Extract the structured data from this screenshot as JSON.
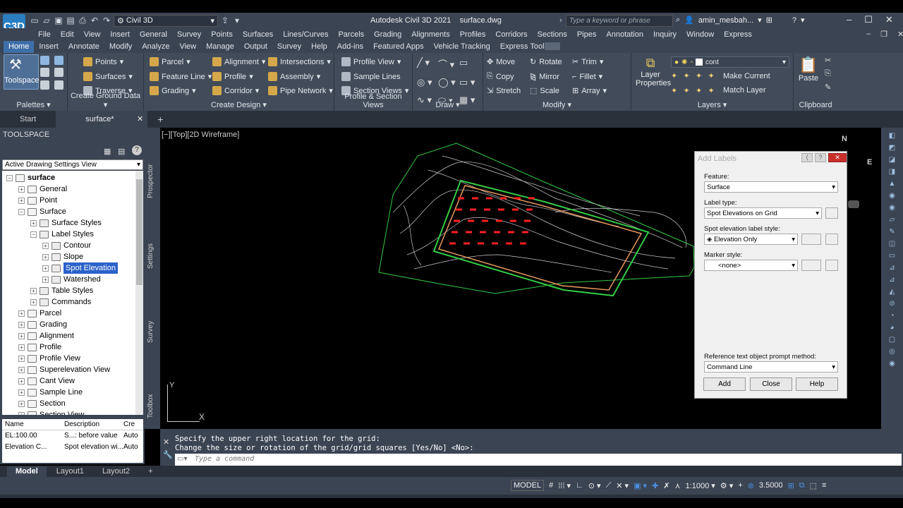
{
  "app": {
    "workspace": "Civil 3D",
    "title": "Autodesk Civil 3D 2021",
    "file": "surface.dwg",
    "search_placeholder": "Type a keyword or phrase",
    "user": "amin_mesbah...",
    "logo": "C3D"
  },
  "menu": [
    "File",
    "Edit",
    "View",
    "Insert",
    "General",
    "Survey",
    "Points",
    "Surfaces",
    "Lines/Curves",
    "Parcels",
    "Grading",
    "Alignments",
    "Profiles",
    "Corridors",
    "Sections",
    "Pipes",
    "Annotation",
    "Inquiry",
    "Window",
    "Express"
  ],
  "tabs": [
    "Home",
    "Insert",
    "Annotate",
    "Modify",
    "Analyze",
    "View",
    "Manage",
    "Output",
    "Survey",
    "Help",
    "Add-ins",
    "Featured Apps",
    "Vehicle Tracking",
    "Express Tools"
  ],
  "ribbon": {
    "palettes": {
      "title": "Palettes",
      "big": "Toolspace"
    },
    "ground": {
      "title": "Create Ground Data",
      "items": [
        "Points",
        "Surfaces",
        "Traverse"
      ]
    },
    "design": {
      "title": "Create Design",
      "items": [
        "Parcel",
        "Feature Line",
        "Grading",
        "Alignment",
        "Profile",
        "Corridor",
        "Intersections",
        "Assembly",
        "Pipe Network"
      ]
    },
    "profile": {
      "title": "Profile & Section Views",
      "items": [
        "Profile View",
        "Sample Lines",
        "Section Views"
      ]
    },
    "draw": {
      "title": "Draw"
    },
    "modify": {
      "title": "Modify",
      "items": [
        "Move",
        "Rotate",
        "Trim",
        "Copy",
        "Mirror",
        "Fillet",
        "Stretch",
        "Scale",
        "Array"
      ]
    },
    "layers": {
      "title": "Layers",
      "big": "Layer Properties",
      "layer": "cont",
      "items": [
        "Make Current",
        "Match Layer"
      ]
    },
    "clipboard": {
      "title": "Clipboard",
      "big": "Paste"
    }
  },
  "doctabs": [
    "Start",
    "surface*"
  ],
  "toolspace": {
    "header": "TOOLSPACE",
    "view": "Active Drawing Settings View",
    "side_tabs": [
      "Prospector",
      "Settings",
      "Survey",
      "Toolbox"
    ],
    "tree": [
      "surface",
      "General",
      "Point",
      "Surface",
      "Surface Styles",
      "Label Styles",
      "Contour",
      "Slope",
      "Spot Elevation",
      "Watershed",
      "Table Styles",
      "Commands",
      "Parcel",
      "Grading",
      "Alignment",
      "Profile",
      "Profile View",
      "Superelevation View",
      "Cant View",
      "Sample Line",
      "Section",
      "Section View"
    ],
    "table": {
      "headers": [
        "Name",
        "Description",
        "Cre"
      ],
      "rows": [
        [
          "EL:100.00",
          "S...: before value",
          "Auto"
        ],
        [
          "Elevation C...",
          "Spot elevation wi...",
          "Auto"
        ]
      ]
    }
  },
  "viewport": {
    "label": "[−][Top][2D Wireframe]",
    "compass": [
      "N",
      "E"
    ],
    "axis": [
      "Y",
      "X"
    ]
  },
  "dialog": {
    "title": "Add Labels",
    "feature_label": "Feature:",
    "feature": "Surface",
    "type_label": "Label type:",
    "type": "Spot Elevations on Grid",
    "style_label": "Spot elevation label style:",
    "style": "Elevation Only",
    "marker_label": "Marker style:",
    "marker": "<none>",
    "ref_label": "Reference text object prompt method:",
    "ref": "Command Line",
    "buttons": [
      "Add",
      "Close",
      "Help"
    ]
  },
  "command": {
    "line1": "Specify the upper right location for the grid:",
    "line2": "Change the size or rotation of the grid/grid squares [Yes/No] <No>:",
    "placeholder": "Type a command"
  },
  "layouts": [
    "Model",
    "Layout1",
    "Layout2"
  ],
  "status": {
    "model": "MODEL",
    "scale": "1:1000",
    "value": "3.5000"
  }
}
